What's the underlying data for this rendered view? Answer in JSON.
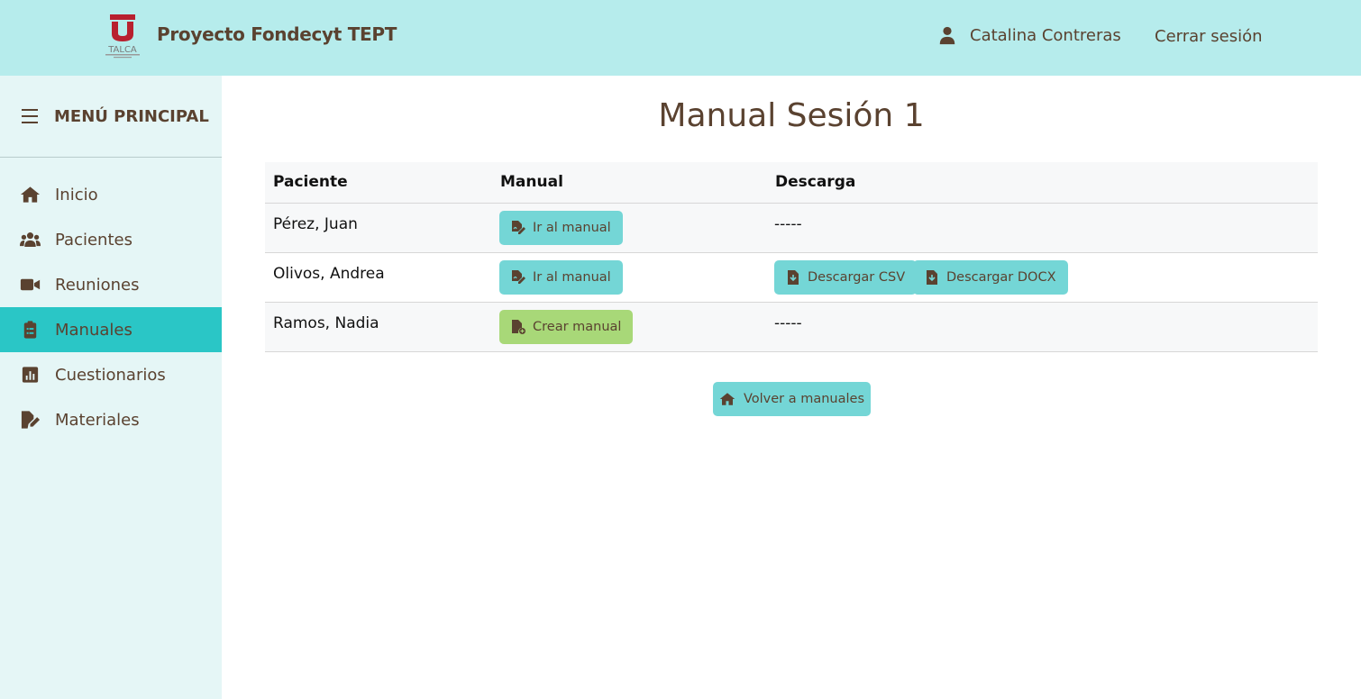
{
  "header": {
    "brand": "Proyecto Fondecyt TEPT",
    "logo_text": "TALCA",
    "user_name": "Catalina Contreras",
    "logout_label": "Cerrar sesión"
  },
  "sidebar": {
    "title": "MENÚ PRINCIPAL",
    "items": [
      {
        "label": "Inicio",
        "icon": "home-icon"
      },
      {
        "label": "Pacientes",
        "icon": "users-icon"
      },
      {
        "label": "Reuniones",
        "icon": "video-icon"
      },
      {
        "label": "Manuales",
        "icon": "clipboard-icon",
        "active": true
      },
      {
        "label": "Cuestionarios",
        "icon": "chart-icon"
      },
      {
        "label": "Materiales",
        "icon": "file-edit-icon"
      }
    ]
  },
  "main": {
    "title": "Manual Sesión 1",
    "columns": [
      "Paciente",
      "Manual",
      "Descarga"
    ],
    "rows": [
      {
        "patient": "Pérez, Juan",
        "manual_action": "Ir al manual",
        "download": "-----"
      },
      {
        "patient": "Olivos, Andrea",
        "manual_action": "Ir al manual",
        "download_csv": "Descargar CSV",
        "download_docx": "Descargar DOCX"
      },
      {
        "patient": "Ramos, Nadia",
        "manual_action": "Crear manual",
        "download": "-----"
      }
    ],
    "back_label": "Volver a manuales"
  },
  "colors": {
    "header_bg": "#b6ecec",
    "sidebar_bg": "#e5f6f6",
    "active_item": "#2ac6c6",
    "button_teal": "#74d6d6",
    "button_green": "#a8d878",
    "text_brown": "#5a4230"
  }
}
